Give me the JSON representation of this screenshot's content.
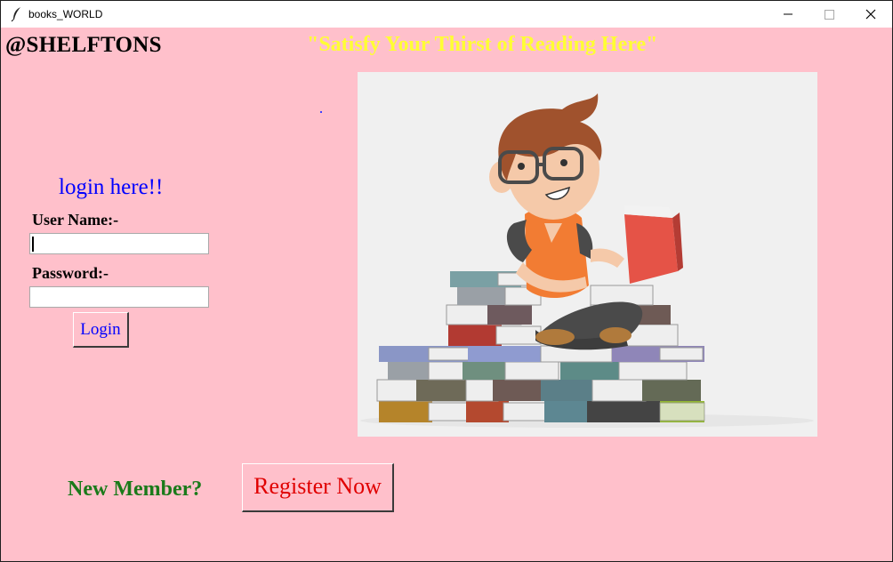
{
  "window": {
    "title": "books_WORLD",
    "icons": {
      "app": "feather-icon",
      "minimize": "minimize-icon",
      "maximize": "maximize-icon",
      "close": "close-icon"
    }
  },
  "header": {
    "brand": "@SHELFTONS",
    "tagline": "\"Satisfy Your Thirst of Reading Here\""
  },
  "login": {
    "heading": "login here!!",
    "username_label": "User Name:-",
    "username_value": "",
    "password_label": "Password:-",
    "password_value": "",
    "button_label": "Login"
  },
  "illustration": {
    "description_icon": "boy-reading-on-books-illustration"
  },
  "register": {
    "prompt": "New Member?",
    "button_label": "Register Now"
  },
  "colors": {
    "background": "#ffc0cb",
    "brand": "#000000",
    "tagline": "#ffff33",
    "login_heading": "#0000ff",
    "login_button_text": "#0000ff",
    "new_member": "#1a7a1a",
    "register_button_text": "#e00000"
  }
}
